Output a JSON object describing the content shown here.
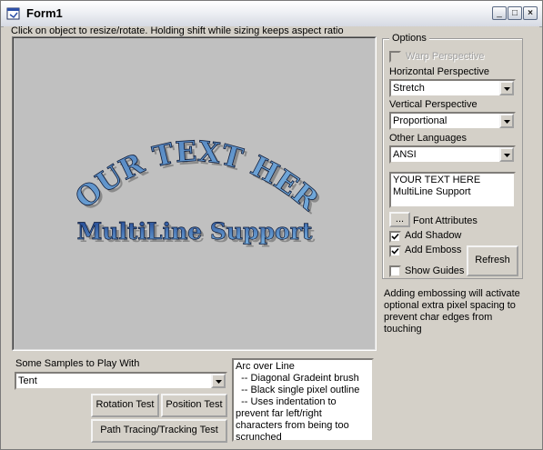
{
  "window": {
    "title": "Form1"
  },
  "instructions": "Click on object to resize/rotate.  Holding shift while sizing keeps aspect ratio",
  "canvas": {
    "lines": [
      "YOUR TEXT HERE",
      "MultiLine Support"
    ],
    "colors": {
      "gradient_top": "#1c3f8c",
      "gradient_bottom": "#6fa6d8",
      "outline": "#0d1a38",
      "shadow": "#8a8a8a"
    }
  },
  "options": {
    "group_title": "Options",
    "warp_perspective_label": "Warp Perspective",
    "horizontal_perspective_label": "Horizontal Perspective",
    "horizontal_perspective_value": "Stretch",
    "vertical_perspective_label": "Vertical Perspective",
    "vertical_perspective_value": "Proportional",
    "other_languages_label": "Other Languages",
    "other_languages_value": "ANSI",
    "text_input": "YOUR TEXT HERE\nMultiLine Support",
    "font_button_label": "...",
    "font_attributes_label": "Font Attributes",
    "add_shadow_label": "Add Shadow",
    "add_emboss_label": "Add Emboss",
    "show_guides_label": "Show Guides",
    "refresh_label": "Refresh",
    "add_shadow_checked": true,
    "add_emboss_checked": true,
    "show_guides_checked": false,
    "warp_perspective_checked": false
  },
  "note": "Adding embossing will activate optional extra pixel spacing to prevent char edges from touching",
  "samples": {
    "label": "Some Samples to Play With",
    "selected": "Tent",
    "description": "Arc over Line\n  -- Diagonal Gradeint brush\n  -- Black single pixel outline\n  -- Uses indentation to prevent far left/right characters from being too scrunched",
    "rotation_test_label": "Rotation Test",
    "position_test_label": "Position Test",
    "path_tracing_label": "Path Tracing/Tracking Test"
  },
  "title_buttons": {
    "minimize": "_",
    "maximize": "□",
    "close": "×"
  }
}
